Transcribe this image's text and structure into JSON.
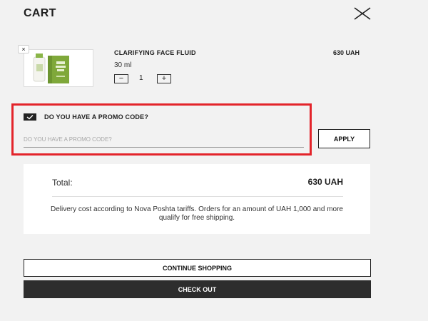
{
  "cart": {
    "title": "CART"
  },
  "item": {
    "name": "CLARIFYING FACE FLUID",
    "volume": "30 ml",
    "quantity": "1",
    "price": "630 UAH",
    "remove_glyph": "×",
    "minus_glyph": "−",
    "plus_glyph": "+",
    "image_icon": "product-bottle-and-box",
    "image_colors": {
      "box": "#7fa83a",
      "bottle": "#f4f4ee",
      "cap": "#8ab548"
    }
  },
  "promo": {
    "checkbox_label": "DO YOU HAVE A PROMO CODE?",
    "checked": true,
    "placeholder": "DO YOU HAVE A PROMO CODE?",
    "value": "",
    "apply_label": "APPLY"
  },
  "summary": {
    "total_label": "Total:",
    "total_value": "630 UAH",
    "delivery_note": "Delivery cost according to Nova Poshta tariffs. Orders for an amount of UAH 1,000 and more qualify for free shipping."
  },
  "actions": {
    "continue_label": "CONTINUE SHOPPING",
    "checkout_label": "CHECK OUT"
  },
  "colors": {
    "background": "#f2f2f2",
    "highlight": "#e3242b",
    "dark_button": "#2d2d2d"
  }
}
